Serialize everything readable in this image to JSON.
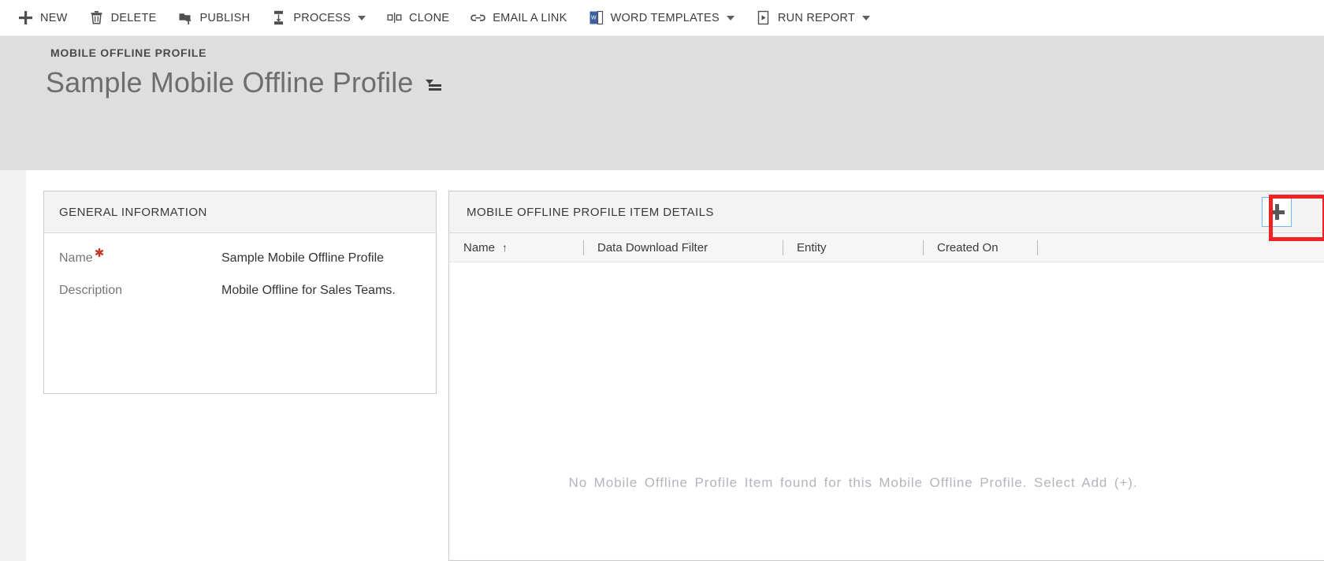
{
  "command_bar": {
    "buttons": [
      {
        "label": "NEW",
        "icon": "plus-icon",
        "has_caret": false
      },
      {
        "label": "DELETE",
        "icon": "trash-icon",
        "has_caret": false
      },
      {
        "label": "PUBLISH",
        "icon": "publish-icon",
        "has_caret": false
      },
      {
        "label": "PROCESS",
        "icon": "process-icon",
        "has_caret": true
      },
      {
        "label": "CLONE",
        "icon": "clone-icon",
        "has_caret": false
      },
      {
        "label": "EMAIL A LINK",
        "icon": "link-icon",
        "has_caret": false
      },
      {
        "label": "WORD TEMPLATES",
        "icon": "word-document-icon",
        "has_caret": true
      },
      {
        "label": "RUN REPORT",
        "icon": "report-icon",
        "has_caret": true
      }
    ]
  },
  "record_header": {
    "entity_type": "MOBILE OFFLINE PROFILE",
    "title": "Sample Mobile Offline Profile",
    "menu_icon": "record-set-navigator-icon"
  },
  "general_information": {
    "heading": "GENERAL INFORMATION",
    "fields": [
      {
        "label": "Name",
        "required": true,
        "value": "Sample Mobile Offline Profile"
      },
      {
        "label": "Description",
        "required": false,
        "value": "Mobile Offline for Sales Teams."
      }
    ]
  },
  "item_details_grid": {
    "heading": "MOBILE OFFLINE PROFILE ITEM DETAILS",
    "add_button_label": "+",
    "add_button_icon": "plus-icon",
    "columns": [
      {
        "label": "Name",
        "sorted": true,
        "sort_arrow": "↑"
      },
      {
        "label": "Data Download Filter",
        "sorted": false,
        "sort_arrow": ""
      },
      {
        "label": "Entity",
        "sorted": false,
        "sort_arrow": ""
      },
      {
        "label": "Created On",
        "sorted": false,
        "sort_arrow": ""
      }
    ],
    "rows": [],
    "empty_message": "No Mobile Offline Profile Item found for this Mobile Offline Profile. Select Add (+)."
  },
  "colors": {
    "header_background": "#dedede",
    "highlight_box": "#ef2323",
    "add_button_border": "#70b5f0",
    "required_star": "#c0392b",
    "section_header_background": "#f3f3f3"
  }
}
